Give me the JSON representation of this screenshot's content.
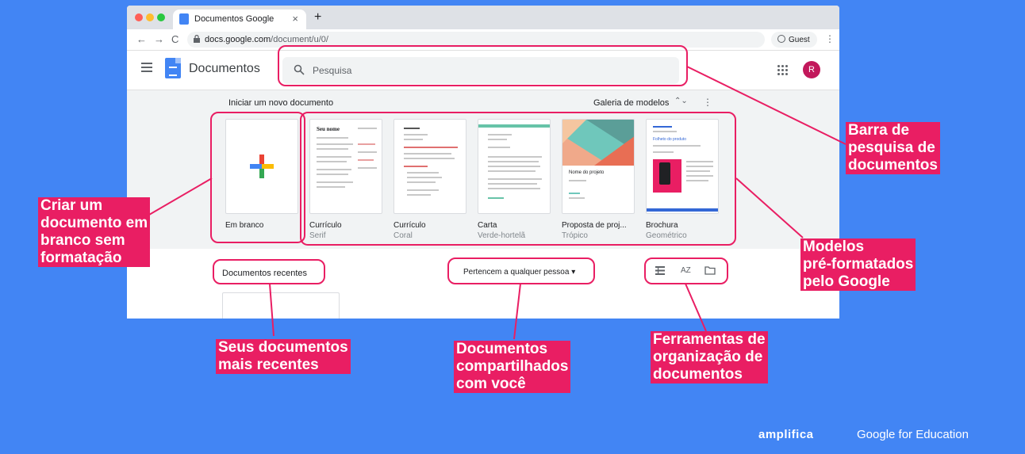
{
  "browser": {
    "tab_title": "Documentos Google",
    "tab_close": "×",
    "new_tab": "+",
    "nav_back": "←",
    "nav_forward": "→",
    "nav_reload": "C",
    "url_domain": "docs.google.com",
    "url_path": "/document/u/0/",
    "profile_label": "Guest",
    "menu_glyph": "⋮",
    "traffic_lights": [
      "#ff5f57",
      "#febc2e",
      "#28c840"
    ]
  },
  "app": {
    "title": "Documentos",
    "avatar_initial": "R",
    "search": {
      "placeholder": "Pesquisa"
    }
  },
  "templates": {
    "section_title": "Iniciar um novo documento",
    "gallery_label": "Galeria de modelos",
    "gallery_arrows": "⌃⌄",
    "more_glyph": "⋮",
    "items": [
      {
        "name": "Em branco",
        "sub": ""
      },
      {
        "name": "Currículo",
        "sub": "Serif"
      },
      {
        "name": "Currículo",
        "sub": "Coral"
      },
      {
        "name": "Carta",
        "sub": "Verde-hortelã"
      },
      {
        "name": "Proposta de proj...",
        "sub": "Trópico"
      },
      {
        "name": "Brochura",
        "sub": "Geométrico"
      }
    ],
    "thumb_text": {
      "serif_heading": "Seu nome",
      "tropico_heading": "Nome do projeto",
      "brochura_heading": "Folheto do produto"
    }
  },
  "recent": {
    "title": "Documentos recentes",
    "owner_filter": "Pertencem a qualquer pessoa",
    "owner_filter_arrow": "▾",
    "sort_label": "AZ"
  },
  "annotations": {
    "search_bar": [
      "Barra de",
      "pesquisa de",
      "documentos"
    ],
    "blank_doc": [
      "Criar um",
      "documento em",
      "branco sem",
      "formatação"
    ],
    "templates": [
      "Modelos",
      "pré-formatados",
      "pelo Google"
    ],
    "recent_docs": [
      "Seus documentos",
      "mais recentes"
    ],
    "shared_docs": [
      "Documentos",
      "compartilhados",
      "com você"
    ],
    "org_tools": [
      "Ferramentas de",
      "organização de",
      "documentos"
    ]
  },
  "branding": {
    "partner": "amplifica",
    "google": "Google for Education"
  },
  "colors": {
    "background": "#4285f4",
    "highlight": "#e91e63",
    "avatar": "#c2185b"
  }
}
